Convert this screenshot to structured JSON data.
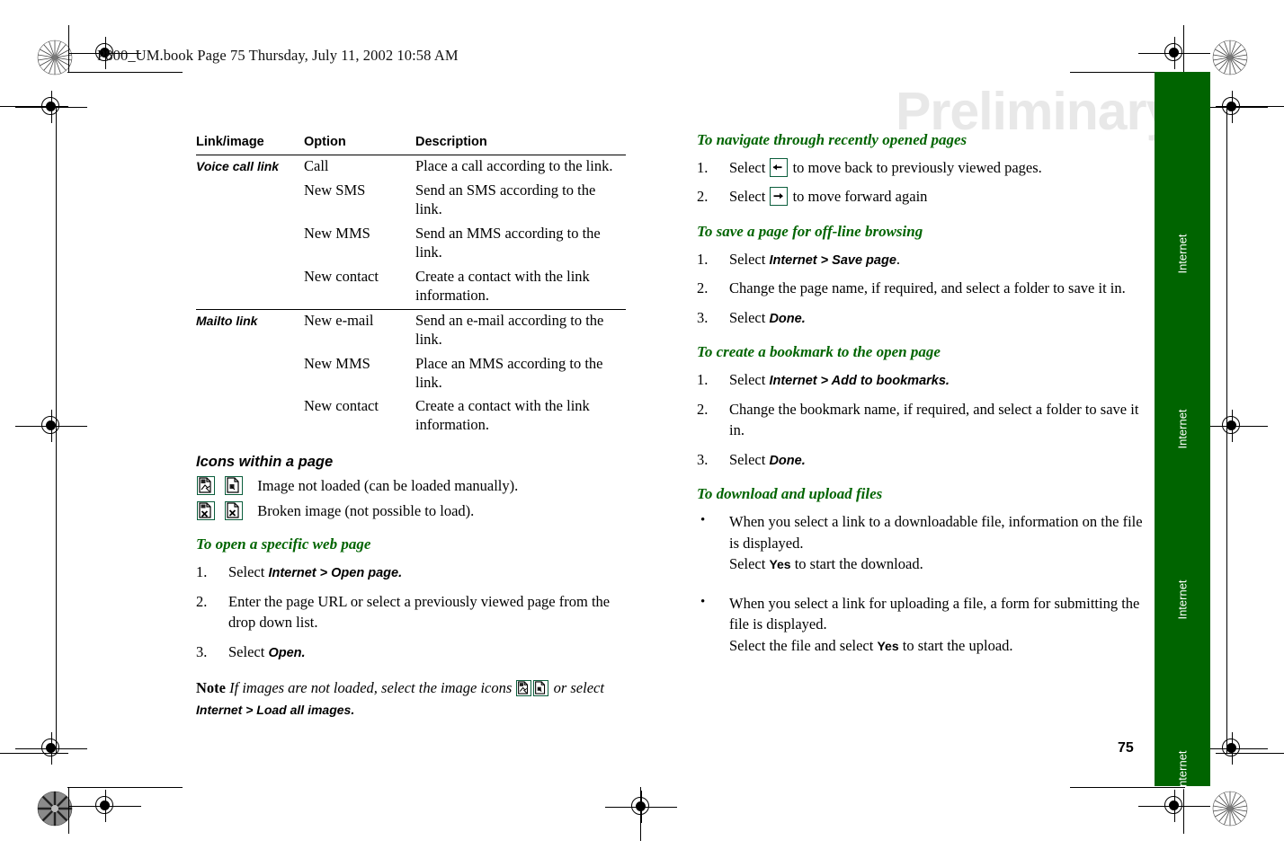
{
  "document": {
    "header_line": "P800_UM.book  Page 75  Thursday, July 11, 2002  10:58 AM",
    "watermark": "Preliminary",
    "page_number": "75",
    "accent_green": "#006400",
    "icon_border_green": "#0b5e3c",
    "watermark_color": "#e8e8e8"
  },
  "side_tab": {
    "label_1": "Internet",
    "label_2": "Internet",
    "label_3": "Internet",
    "label_4": "Internet"
  },
  "table": {
    "headers": {
      "link_image": "Link/image",
      "option": "Option",
      "description": "Description"
    },
    "groups": [
      {
        "kind": "Voice call link",
        "rows": [
          {
            "option": "Call",
            "description": "Place a call according to the link."
          },
          {
            "option": "New SMS",
            "description": "Send an SMS according to the link."
          },
          {
            "option": "New MMS",
            "description": "Send an MMS according to the link."
          },
          {
            "option": "New contact",
            "description": "Create a contact with the link information."
          }
        ]
      },
      {
        "kind": "Mailto link",
        "rows": [
          {
            "option": "New e-mail",
            "description": "Send an e-mail according to the link."
          },
          {
            "option": "New MMS",
            "description": "Place an MMS according to the link."
          },
          {
            "option": "New contact",
            "description": "Create a contact with the link information."
          }
        ]
      }
    ]
  },
  "icons_section": {
    "heading": "Icons within a page",
    "rows": [
      {
        "text": "Image not loaded (can be loaded manually)."
      },
      {
        "text": "Broken image (not possible to load)."
      }
    ]
  },
  "open_page_section": {
    "heading": "To open a specific web page",
    "steps": [
      {
        "num": "1.",
        "pre": "Select ",
        "ui": "Internet > Open page.",
        "post": ""
      },
      {
        "num": "2.",
        "pre": "Enter the page URL or select a previously viewed page from the drop down list.",
        "ui": "",
        "post": ""
      },
      {
        "num": "3.",
        "pre": "Select ",
        "ui": "Open.",
        "post": ""
      }
    ]
  },
  "note": {
    "label": "Note",
    "text_before": " If images are not loaded, select the image icons ",
    "text_middle": " or select ",
    "ui": "Internet > Load all images."
  },
  "navigate_section": {
    "heading": "To navigate through recently opened pages",
    "steps": [
      {
        "num": "1.",
        "pre": "Select ",
        "post": " to move back to previously viewed pages.",
        "icon": "arrow-left-icon"
      },
      {
        "num": "2.",
        "pre": "Select ",
        "post": " to move forward again",
        "icon": "arrow-right-icon"
      }
    ]
  },
  "save_page_section": {
    "heading": "To save a page for off-line browsing",
    "steps": [
      {
        "num": "1.",
        "pre": "Select ",
        "ui": "Internet > Save page",
        "post": "."
      },
      {
        "num": "2.",
        "pre": "Change the page name, if required, and select a folder to save it in.",
        "ui": "",
        "post": ""
      },
      {
        "num": "3.",
        "pre": "Select ",
        "ui": "Done.",
        "post": ""
      }
    ]
  },
  "bookmark_section": {
    "heading": "To create a bookmark to the open page",
    "steps": [
      {
        "num": "1.",
        "pre": "Select ",
        "ui": "Internet > Add to bookmarks.",
        "post": ""
      },
      {
        "num": "2.",
        "pre": "Change the bookmark name, if required, and select a folder to save it in.",
        "ui": "",
        "post": ""
      },
      {
        "num": "3.",
        "pre": "Select ",
        "ui": "Done.",
        "post": ""
      }
    ]
  },
  "download_section": {
    "heading": "To download and upload files",
    "bullets": [
      {
        "num": "•",
        "line1": "When you select a link to a downloadable file, information on the file is displayed.",
        "line2_pre": "Select ",
        "line2_ui": "Yes",
        "line2_post": " to start the download."
      },
      {
        "num": "•",
        "line1": "When you select a link for uploading a file, a form for submitting the file is displayed.",
        "line2_pre": "Select the file and select ",
        "line2_ui": "Yes",
        "line2_post": " to start the upload."
      }
    ]
  }
}
